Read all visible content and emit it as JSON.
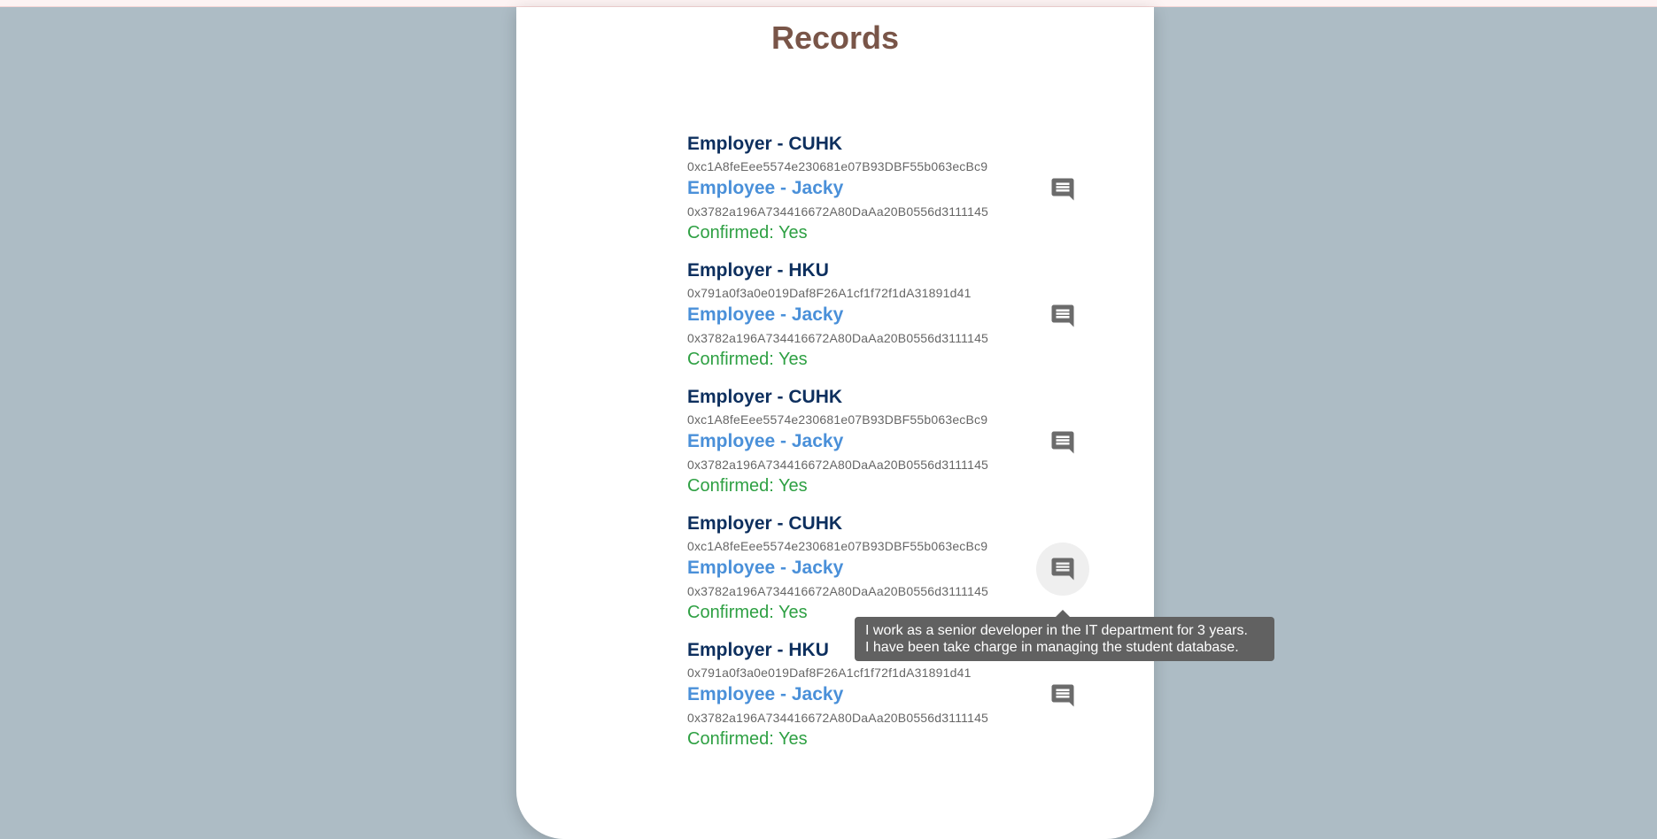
{
  "page": {
    "title": "Records"
  },
  "records": [
    {
      "employer": "Employer - CUHK",
      "employer_address": "0xc1A8feEee5574e230681e07B93DBF55b063ecBc9",
      "employee": "Employee - Jacky",
      "employee_address": "0x3782a196A734416672A80DaAa20B0556d3111145",
      "confirmed": "Confirmed: Yes"
    },
    {
      "employer": "Employer - HKU",
      "employer_address": "0x791a0f3a0e019Daf8F26A1cf1f72f1dA31891d41",
      "employee": "Employee - Jacky",
      "employee_address": "0x3782a196A734416672A80DaAa20B0556d3111145",
      "confirmed": "Confirmed: Yes"
    },
    {
      "employer": "Employer - CUHK",
      "employer_address": "0xc1A8feEee5574e230681e07B93DBF55b063ecBc9",
      "employee": "Employee - Jacky",
      "employee_address": "0x3782a196A734416672A80DaAa20B0556d3111145",
      "confirmed": "Confirmed: Yes"
    },
    {
      "employer": "Employer - CUHK",
      "employer_address": "0xc1A8feEee5574e230681e07B93DBF55b063ecBc9",
      "employee": "Employee - Jacky",
      "employee_address": "0x3782a196A734416672A80DaAa20B0556d3111145",
      "confirmed": "Confirmed: Yes"
    },
    {
      "employer": "Employer - HKU",
      "employer_address": "0x791a0f3a0e019Daf8F26A1cf1f72f1dA31891d41",
      "employee": "Employee - Jacky",
      "employee_address": "0x3782a196A734416672A80DaAa20B0556d3111145",
      "confirmed": "Confirmed: Yes"
    }
  ],
  "tooltip": {
    "line1": "I work as a senior developer in the IT department for 3 years.",
    "line2": "I have been take charge in managing the student database."
  },
  "icons": {
    "comment": "comment-icon"
  },
  "colors": {
    "background": "#adbcc5",
    "title": "#795548",
    "employer": "#0d2f5e",
    "employee": "#4a90d9",
    "confirmed": "#2ea043",
    "tooltip": "#616161"
  }
}
